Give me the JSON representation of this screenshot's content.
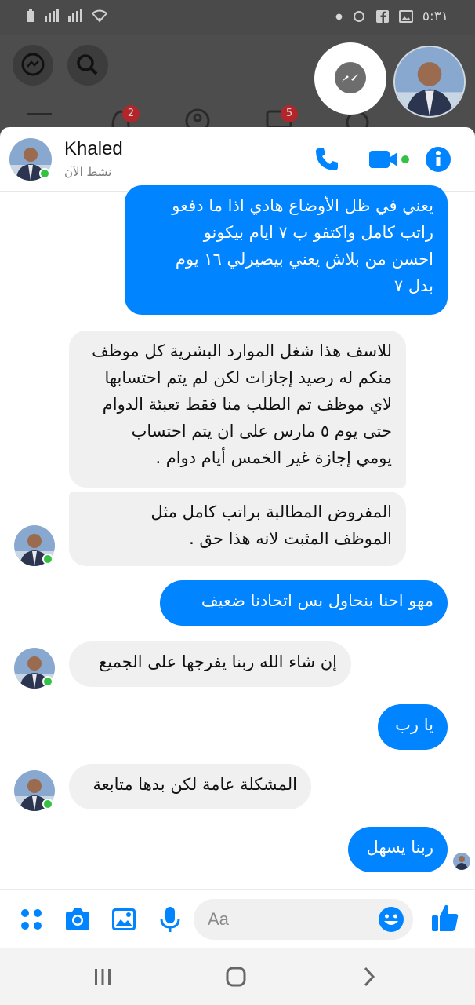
{
  "status_bar": {
    "time": "٥:٣١"
  },
  "fb_background": {
    "badges": [
      "2",
      "5"
    ]
  },
  "chat": {
    "contact_name": "Khaled",
    "contact_status": "نشط الآن",
    "composer_placeholder": "Aa",
    "messages": [
      {
        "side": "out",
        "text": "يعني في ظل الأوضاع هادي اذا ما دفعو\nراتب كامل واكتفو ب ٧ ايام بيكونو\nاحسن من بلاش يعني بيصيرلي ١٦ يوم\nبدل ٧"
      },
      {
        "side": "in",
        "text": "للاسف هذا شغل الموارد البشرية كل موظف\nمنكم له رصيد إجازات لكن لم يتم احتسابها\nلاي موظف تم الطلب منا فقط تعبئة الدوام\nحتى يوم ٥ مارس على ان يتم احتساب\nيومي إجازة غير الخمس أيام دوام ."
      },
      {
        "side": "in",
        "text": "المفروض المطالبة براتب كامل مثل\nالموظف المثبت لانه هذا حق ."
      },
      {
        "side": "out",
        "text": "مهو احنا بنحاول بس اتحادنا ضعيف"
      },
      {
        "side": "in",
        "text": "إن شاء الله ربنا يفرجها على الجميع"
      },
      {
        "side": "out",
        "text": "يا رب"
      },
      {
        "side": "in",
        "text": "المشكلة عامة لكن بدها متابعة"
      },
      {
        "side": "out",
        "text": "ربنا يسهل"
      }
    ]
  },
  "colors": {
    "accent": "#0084ff",
    "incoming_bubble": "#f0f0f0",
    "online": "#35c144",
    "badge": "#b0262b"
  }
}
